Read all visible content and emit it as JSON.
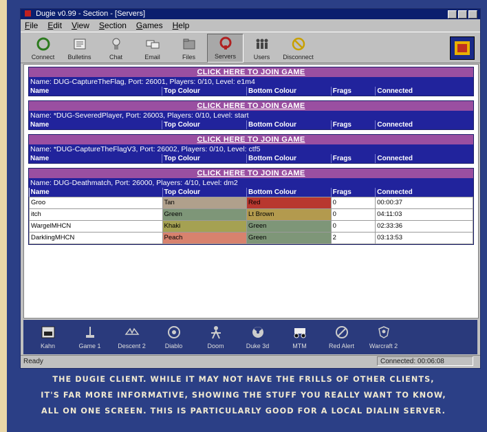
{
  "window": {
    "title": "Dugie v0.99 - Section - [Servers]"
  },
  "menu": [
    "File",
    "Edit",
    "View",
    "Section",
    "Games",
    "Help"
  ],
  "toolbar": [
    {
      "label": "Connect",
      "icon": "connect-icon"
    },
    {
      "label": "Bulletins",
      "icon": "bulletins-icon"
    },
    {
      "label": "Chat",
      "icon": "chat-icon"
    },
    {
      "label": "Email",
      "icon": "email-icon"
    },
    {
      "label": "Files",
      "icon": "files-icon"
    },
    {
      "label": "Servers",
      "icon": "servers-icon",
      "active": true
    },
    {
      "label": "Users",
      "icon": "users-icon"
    },
    {
      "label": "Disconnect",
      "icon": "disconnect-icon"
    }
  ],
  "servers": [
    {
      "join_label": "CLICK HERE TO JOIN GAME",
      "info": "Name: DUG-CaptureTheFlag, Port: 26001, Players: 0/10, Level: e1m4",
      "players": []
    },
    {
      "join_label": "CLICK HERE TO JOIN GAME",
      "info": "Name: *DUG-SeveredPlayer, Port: 26003, Players: 0/10, Level: start",
      "players": []
    },
    {
      "join_label": "CLICK HERE TO JOIN GAME",
      "info": "Name: *DUG-CaptureTheFlagV3, Port: 26002, Players: 0/10, Level: ctf5",
      "players": []
    },
    {
      "join_label": "CLICK HERE TO JOIN GAME",
      "info": "Name: DUG-Deathmatch, Port: 26000, Players: 4/10, Level: dm2",
      "players": [
        {
          "name": "Groo",
          "top": "Tan",
          "top_color": "#b0a08c",
          "bottom": "Red",
          "bottom_color": "#b8382f",
          "frags": "0",
          "connected": "00:00:37"
        },
        {
          "name": "itch",
          "top": "Green",
          "top_color": "#7e9678",
          "bottom": "Lt Brown",
          "bottom_color": "#b39a4e",
          "frags": "0",
          "connected": "04:11:03"
        },
        {
          "name": "WargelMHCN",
          "top": "Khaki",
          "top_color": "#a5a152",
          "bottom": "Green",
          "bottom_color": "#7e9678",
          "frags": "0",
          "connected": "02:33:36"
        },
        {
          "name": "DarklingMHCN",
          "top": "Peach",
          "top_color": "#d8826e",
          "bottom": "Green",
          "bottom_color": "#7e9678",
          "frags": "2",
          "connected": "03:13:53"
        }
      ]
    }
  ],
  "columns": [
    "Name",
    "Top Colour",
    "Bottom Colour",
    "Frags",
    "Connected"
  ],
  "games": [
    {
      "label": "Kahn",
      "icon": "kahn-icon"
    },
    {
      "label": "Game 1",
      "icon": "joystick-icon"
    },
    {
      "label": "Descent 2",
      "icon": "descent-icon"
    },
    {
      "label": "Diablo",
      "icon": "diablo-icon"
    },
    {
      "label": "Doom",
      "icon": "doom-icon"
    },
    {
      "label": "Duke 3d",
      "icon": "radiation-icon"
    },
    {
      "label": "MTM",
      "icon": "truck-icon"
    },
    {
      "label": "Red Alert",
      "icon": "redalert-icon"
    },
    {
      "label": "Warcraft 2",
      "icon": "warcraft-icon"
    }
  ],
  "status": {
    "left": "Ready",
    "right": "Connected: 00:06:08"
  },
  "caption": [
    "THE DUGIE CLIENT. WHILE IT MAY NOT HAVE THE FRILLS OF OTHER CLIENTS,",
    "IT'S FAR MORE INFORMATIVE, SHOWING THE STUFF YOU REALLY WANT TO KNOW,",
    "ALL ON ONE SCREEN. THIS IS PARTICULARLY GOOD FOR A LOCAL DIALIN SERVER."
  ]
}
